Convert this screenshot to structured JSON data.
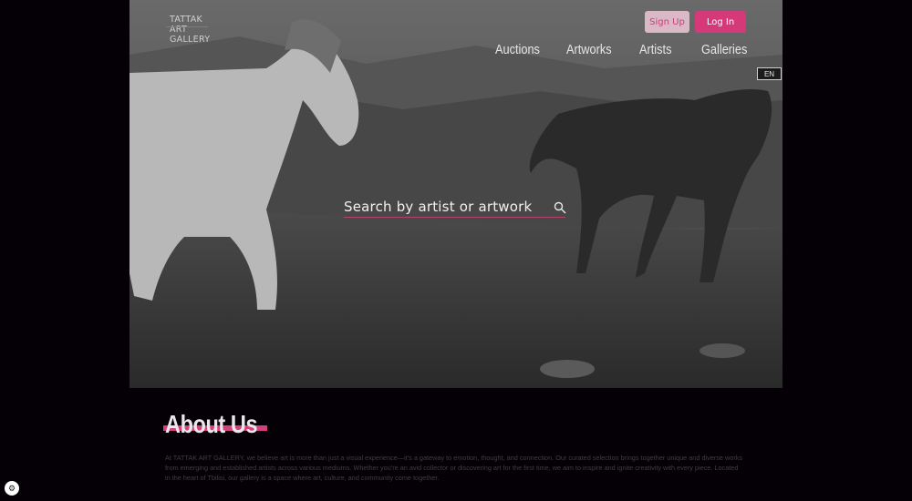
{
  "brand": {
    "logo_lines": [
      "TATTAK",
      "ART",
      "GALLERY"
    ]
  },
  "auth": {
    "signup_label": "Sign Up",
    "login_label": "Log In"
  },
  "nav": {
    "items": [
      "Auctions",
      "Artworks",
      "Artists",
      "Galleries"
    ]
  },
  "lang": {
    "current": "EN"
  },
  "search": {
    "placeholder": "Search by artist or artwork"
  },
  "about": {
    "title": "About Us",
    "text": "At TATTAK ART GALLERY, we believe art is more than just a visual experience—it's a gateway to emotion, thought, and connection. Our curated selection brings together unique and diverse works from emerging and established artists across various mediums. Whether you're an avid collector or discovering art for the first time, we aim to inspire and ignite creativity with every piece. Located in the heart of Tbilisi, our gallery is a space where art, culture, and community come together."
  },
  "colors": {
    "accent": "#d5397a",
    "background": "#050005"
  },
  "icons": {
    "search": "search-icon",
    "badge": "widget-icon"
  }
}
